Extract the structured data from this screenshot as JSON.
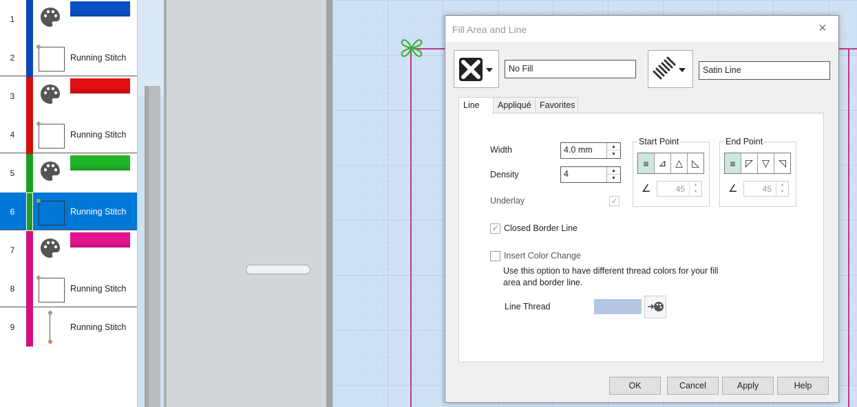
{
  "sequence": [
    {
      "num": "1",
      "color": "#0a47b8",
      "kind": "palette",
      "bar": "#0b4fc8"
    },
    {
      "num": "2",
      "color": "#0a47b8",
      "kind": "box",
      "label": "Running Stitch"
    },
    {
      "num": "3",
      "color": "#d40f0f",
      "kind": "palette",
      "bar": "#e30f12"
    },
    {
      "num": "4",
      "color": "#d40f0f",
      "kind": "box",
      "label": "Running Stitch"
    },
    {
      "num": "5",
      "color": "#1c9e22",
      "kind": "palette",
      "bar": "#22b329"
    },
    {
      "num": "6",
      "color": "#1c9e22",
      "kind": "box",
      "label": "Running Stitch",
      "selected": true
    },
    {
      "num": "7",
      "color": "#d0127f",
      "kind": "palette",
      "bar": "#e5148f"
    },
    {
      "num": "8",
      "color": "#d0127f",
      "kind": "box",
      "label": "Running Stitch"
    },
    {
      "num": "9",
      "color": "#d0127f",
      "kind": "line",
      "label": "Running Stitch"
    }
  ],
  "dialog": {
    "title": "Fill Area and Line",
    "fill_type": "No Fill",
    "line_type": "Satin Line",
    "tabs": [
      {
        "label": "Line"
      },
      {
        "label": "Appliqué"
      },
      {
        "label": "Favorites"
      }
    ],
    "line": {
      "width_label": "Width",
      "width_value": "4.0 mm",
      "density_label": "Density",
      "density_value": "4",
      "underlay_label": "Underlay",
      "start_point_title": "Start Point",
      "start_angle": "45",
      "end_point_title": "End Point",
      "end_angle": "45",
      "closed_border_label": "Closed Border Line",
      "insert_color_label": "Insert Color Change",
      "description": "Use this option to have different thread colors for your fill area and border line.",
      "line_thread_label": "Line Thread",
      "line_thread_color": "#b4c8e4"
    },
    "buttons": {
      "ok": "OK",
      "cancel": "Cancel",
      "apply": "Apply",
      "help": "Help"
    }
  },
  "colors": {
    "selection": "#0078d7",
    "outline": "#c0398b",
    "handle": "#3aa84a"
  }
}
